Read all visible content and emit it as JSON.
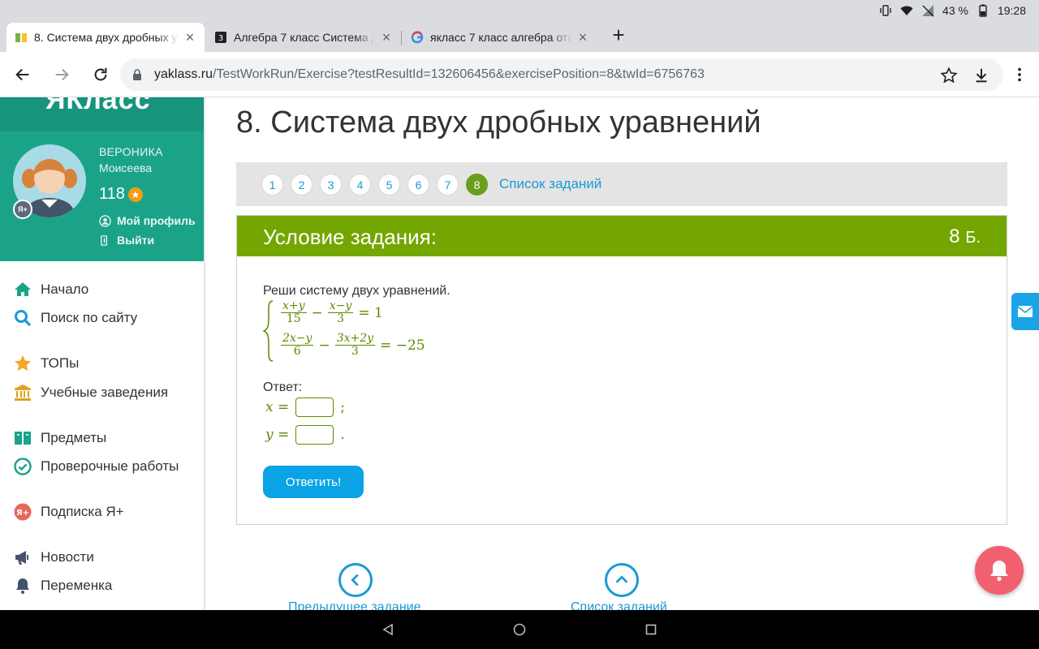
{
  "statusbar": {
    "battery": "43 %",
    "time": "19:28"
  },
  "tabs": [
    {
      "title": "8. Система двух дробных у",
      "close": "×"
    },
    {
      "title": "Алгебра 7 класс Система д",
      "close": "×"
    },
    {
      "title": "якласс 7 класс алгебра отв",
      "close": "×"
    }
  ],
  "newtab": "+",
  "omnibox": {
    "host": "yaklass.ru",
    "path": "/TestWorkRun/Exercise?testResultId=132606456&exercisePosition=8&twId=6756763"
  },
  "sidebar": {
    "logo": "ЯКласс",
    "avatar_badge": "Я+",
    "user_first": "ВЕРОНИКА",
    "user_last": "Моисеева",
    "points": "118",
    "my_profile": "Мой профиль",
    "logout": "Выйти",
    "menu": [
      {
        "label": "Начало",
        "icon": "home-icon"
      },
      {
        "label": "Поиск по сайту",
        "icon": "search-icon"
      },
      {
        "label": "ТОПы",
        "icon": "star-icon"
      },
      {
        "label": "Учебные заведения",
        "icon": "institution-icon"
      },
      {
        "label": "Предметы",
        "icon": "book-icon"
      },
      {
        "label": "Проверочные работы",
        "icon": "check-circle-icon"
      },
      {
        "label": "Подписка Я+",
        "icon": "ya-plus-icon"
      },
      {
        "label": "Новости",
        "icon": "megaphone-icon"
      },
      {
        "label": "Переменка",
        "icon": "bell-icon"
      }
    ]
  },
  "main": {
    "title": "8. Система двух дробных уравнений",
    "task_numbers": [
      "1",
      "2",
      "3",
      "4",
      "5",
      "6",
      "7",
      "8"
    ],
    "current_task": "8",
    "task_list_link": "Список заданий",
    "card": {
      "heading": "Условие задания:",
      "points": "8",
      "points_unit": "Б.",
      "task_text": "Реши систему двух уравнений.",
      "eq1": {
        "f1_num": "x+y",
        "f1_den": "15",
        "op": "−",
        "f2_num": "x−y",
        "f2_den": "3",
        "rhs": "= 1"
      },
      "eq2": {
        "f1_num": "2x−y",
        "f1_den": "6",
        "op": "−",
        "f2_num": "3x+2y",
        "f2_den": "3",
        "rhs": "= −25"
      },
      "answer_label": "Ответ:",
      "x_label": "x =",
      "x_value": "",
      "x_sep": ";",
      "y_label": "y =",
      "y_value": "",
      "y_sep": ".",
      "submit": "Ответить!"
    },
    "prev_task": "Предыдущее задание",
    "task_list": "Список заданий"
  }
}
